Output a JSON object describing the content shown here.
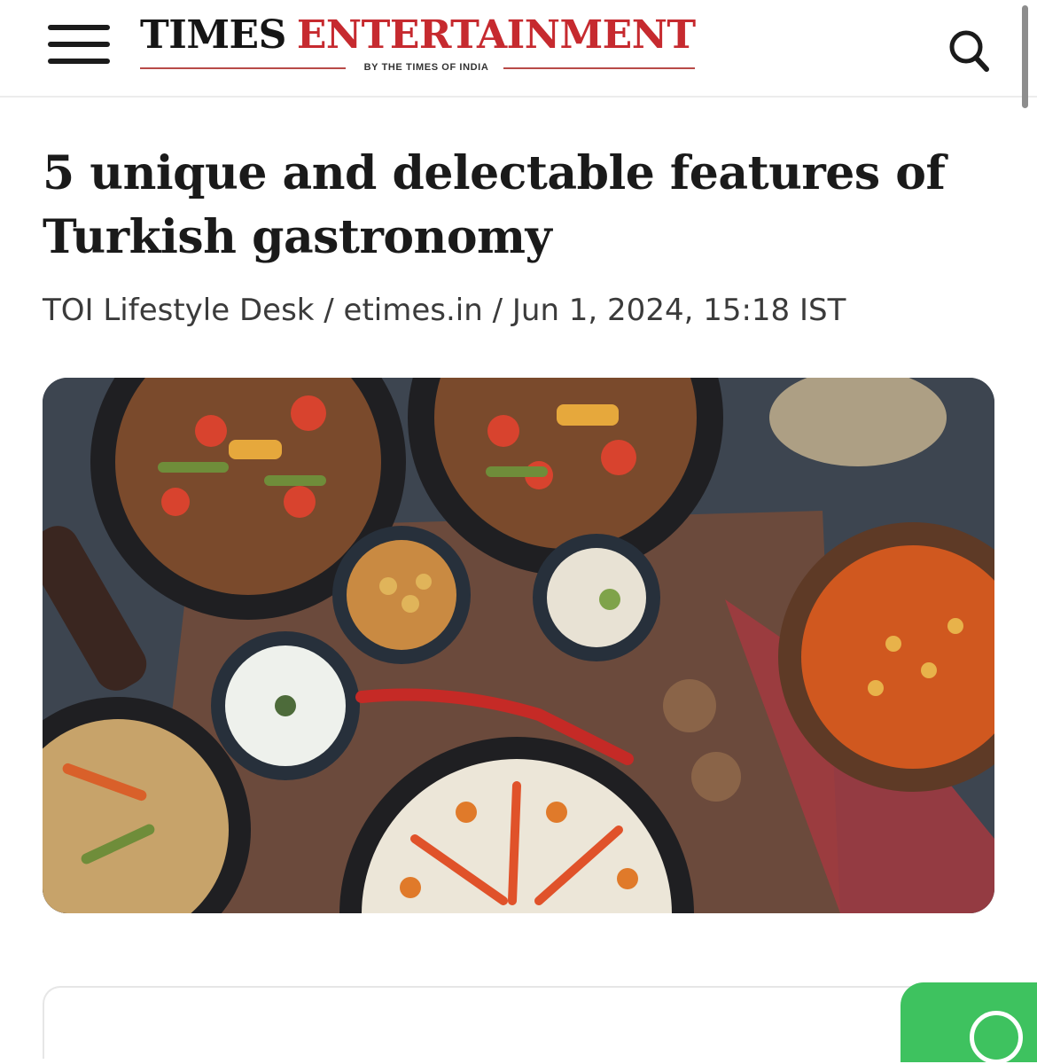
{
  "header": {
    "menu_icon": "hamburger-menu-icon",
    "logo_times": "TIMES",
    "logo_entertainment": "ENTERTAINMENT",
    "logo_tagline": "BY THE TIMES OF INDIA",
    "search_icon": "search-icon",
    "colors": {
      "logo_red": "#c62a2f",
      "logo_dark": "#151515"
    }
  },
  "article": {
    "title": "5 unique and delectable features of Turkish gastronomy",
    "byline": "TOI Lifestyle Desk / etimes.in / Jun 1, 2024, 15:18 IST",
    "hero_image": "turkish-food-spread-photo"
  },
  "floating": {
    "whatsapp_icon": "whatsapp-icon",
    "colors": {
      "whatsapp_green": "#3ec25f"
    }
  }
}
